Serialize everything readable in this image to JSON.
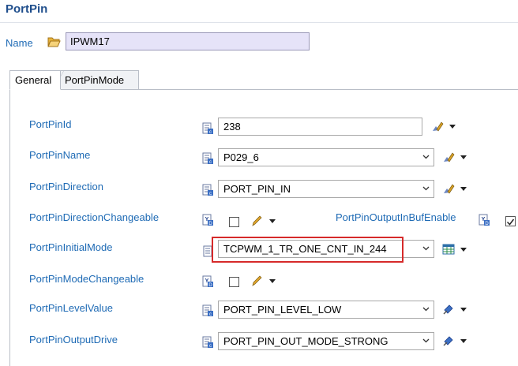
{
  "header": {
    "title": "PortPin"
  },
  "name_row": {
    "label": "Name",
    "value": "IPWM17",
    "icon": "folder-open-icon"
  },
  "tabs": [
    {
      "label": "General",
      "active": true
    },
    {
      "label": "PortPinMode",
      "active": false
    }
  ],
  "fields": {
    "port_pin_id": {
      "label": "PortPinId",
      "value": "238"
    },
    "port_pin_name": {
      "label": "PortPinName",
      "value": "P029_6"
    },
    "port_pin_direction": {
      "label": "PortPinDirection",
      "value": "PORT_PIN_IN"
    },
    "port_pin_direction_changeable": {
      "label": "PortPinDirectionChangeable",
      "checked": false
    },
    "port_pin_output_in_buf_enable": {
      "label": "PortPinOutputInBufEnable",
      "checked": true
    },
    "port_pin_initial_mode": {
      "label": "PortPinInitialMode",
      "value": "TCPWM_1_TR_ONE_CNT_IN_244"
    },
    "port_pin_mode_changeable": {
      "label": "PortPinModeChangeable",
      "checked": false
    },
    "port_pin_level_value": {
      "label": "PortPinLevelValue",
      "value": "PORT_PIN_LEVEL_LOW"
    },
    "port_pin_output_drive": {
      "label": "PortPinOutputDrive",
      "value": "PORT_PIN_OUT_MODE_STRONG"
    }
  },
  "colors": {
    "label_blue": "#1f6bb5",
    "title_blue": "#1f4e8c",
    "highlight_red": "#d62a2a",
    "name_bg": "#e6e3f8"
  }
}
